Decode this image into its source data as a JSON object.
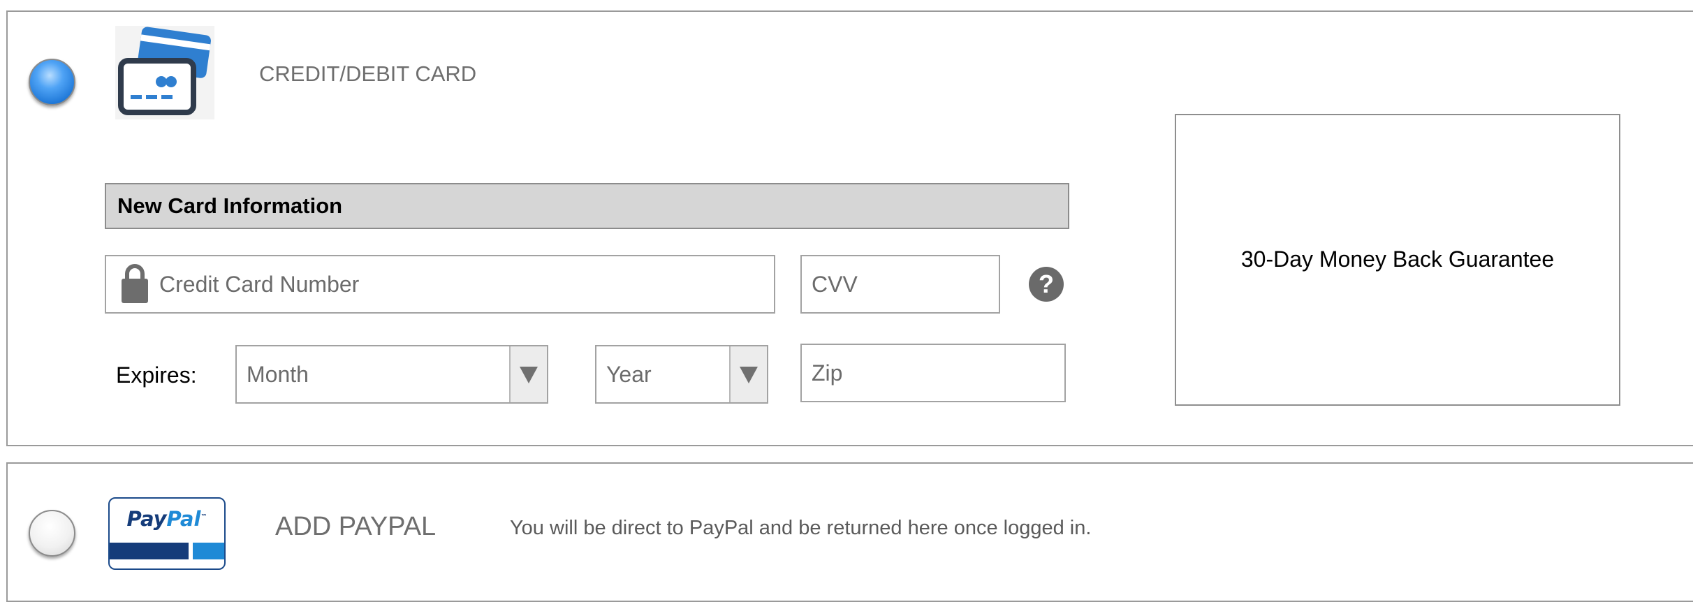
{
  "payment_methods": {
    "card": {
      "label": "CREDIT/DEBIT CARD",
      "selected": true,
      "icon": "credit-card-icon"
    },
    "paypal": {
      "label": "ADD PAYPAL",
      "selected": false,
      "logo_text_1": "Pay",
      "logo_text_2": "Pal",
      "logo_tm": "™",
      "note": "You will be direct to PayPal and be returned here once logged in."
    }
  },
  "card_form": {
    "header": "New Card Information",
    "card_number_placeholder": "Credit Card Number",
    "cvv_placeholder": "CVV",
    "help_symbol": "?",
    "expires_label": "Expires:",
    "month_selected": "Month",
    "year_selected": "Year",
    "zip_placeholder": "Zip"
  },
  "guarantee": {
    "text": "30-Day Money Back Guarantee"
  },
  "colors": {
    "radio_selected": "#3b8fe6",
    "header_bg": "#d6d6d6",
    "paypal_dark": "#153c7a",
    "paypal_light": "#1f8ad6"
  }
}
